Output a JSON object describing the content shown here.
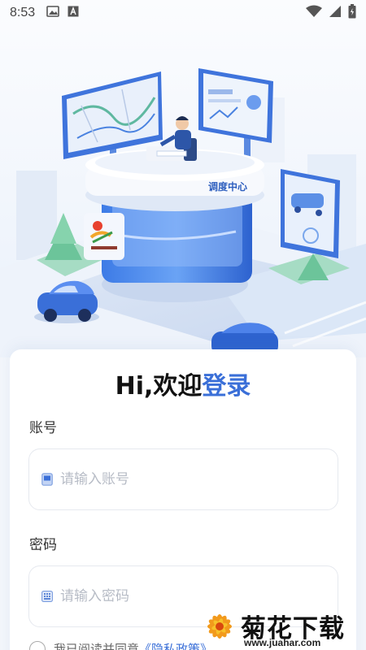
{
  "status_bar": {
    "time": "8:53",
    "icons": [
      "image-icon",
      "text-a-icon",
      "wifi-icon",
      "signal-icon",
      "battery-icon"
    ]
  },
  "hero": {
    "building_sign": "调度中心",
    "logo_text": "调度中心",
    "colors": {
      "accent": "#3a6fd8",
      "panel": "#4a7ee6",
      "grass": "#8fd3b6"
    }
  },
  "login": {
    "title_prefix": "Hi,欢迎",
    "title_accent": "登录",
    "account_label": "账号",
    "account_placeholder": "请输入账号",
    "account_value": "",
    "password_label": "密码",
    "password_placeholder": "请输入密码",
    "password_value": "",
    "agree_prefix": "我已阅读并同意",
    "agree_link": "《隐私政策》"
  },
  "watermark": {
    "name": "菊花下载网",
    "url": "www.juahar.com"
  }
}
